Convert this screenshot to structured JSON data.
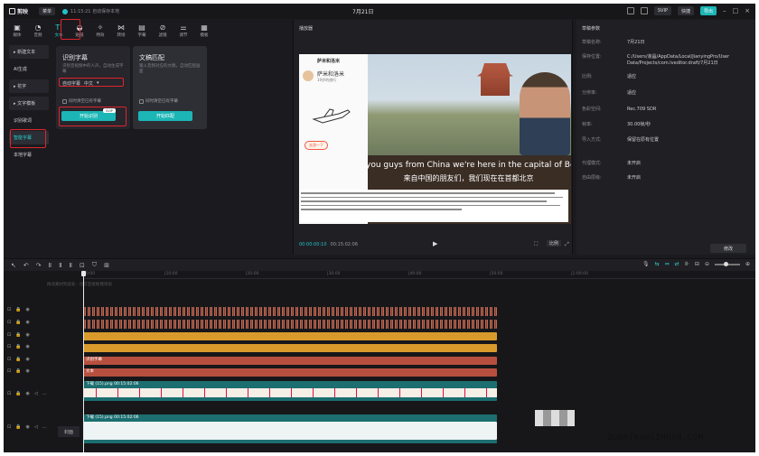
{
  "app": {
    "name": "剪映",
    "menu": "菜单",
    "project_title": "7月21日",
    "autosave": "11:15:21 自动保存本地"
  },
  "title_right": {
    "pro_label": "SVIP",
    "shortcut_label": "快捷",
    "export_label": "导出"
  },
  "toolbar": {
    "tools": [
      {
        "glyph": "▣",
        "label": "媒体"
      },
      {
        "glyph": "◔",
        "label": "音频"
      },
      {
        "glyph": "TI",
        "label": "文本"
      },
      {
        "glyph": "◒",
        "label": "贴纸"
      },
      {
        "glyph": "✧",
        "label": "特效"
      },
      {
        "glyph": "⋈",
        "label": "转场"
      },
      {
        "glyph": "▤",
        "label": "字幕"
      },
      {
        "glyph": "⊘",
        "label": "滤镜"
      },
      {
        "glyph": "⚌",
        "label": "调节"
      },
      {
        "glyph": "▦",
        "label": "模板"
      }
    ]
  },
  "sidebar": {
    "items": [
      {
        "label": "▸ 新建文本"
      },
      {
        "label": "AI生成"
      },
      {
        "label": "▸ 花字"
      },
      {
        "label": "▸ 文字模板"
      },
      {
        "label": "识别歌词"
      },
      {
        "label": "智能字幕"
      },
      {
        "label": "本地字幕"
      }
    ]
  },
  "card_recognize": {
    "title": "识别字幕",
    "desc": "识别音视频中的人声，自动生成字幕",
    "lang": "自动字幕",
    "lang2": "中文",
    "check": "同时清空已有字幕",
    "button": "开始识别",
    "badge": "SVIP"
  },
  "card_match": {
    "title": "文稿匹配",
    "desc": "输入音频对应的文稿，自动匹配画面",
    "check": "同时清空已有字幕",
    "button": "开始匹配"
  },
  "player": {
    "title": "播放器",
    "phone_title": "萨米和洛米",
    "phone_name": "萨米和洛米",
    "phone_sub": "19岁的旅行",
    "tag_text": "去游一下",
    "sub_en": "you guys from China we're here in the capital of Beijing",
    "sub_zh": "来自中国的朋友们，我们现在在首都北京",
    "timecode_current": "00:00:00:10",
    "timecode_total": "00:15:02:06",
    "ratio": "比例"
  },
  "props": {
    "title": "草稿参数",
    "rows": [
      {
        "k": "草稿名称:",
        "v": "7月21日"
      },
      {
        "k": "保存位置:",
        "v": "C:/Users/液晶/AppData/Local/JianyingPro/User Data/Projects/com.lveditor.draft/7月21日"
      },
      {
        "k": "比例:",
        "v": "适应"
      },
      {
        "k": "分辨率:",
        "v": "适应"
      },
      {
        "k": "色彩空间:",
        "v": "Rec.709 SDR"
      },
      {
        "k": "帧率:",
        "v": "30.00帧/秒"
      },
      {
        "k": "导入方式:",
        "v": "保留在原有位置"
      },
      {
        "k": "代理模式:",
        "v": "未开启"
      },
      {
        "k": "自由层级:",
        "v": "未开启"
      }
    ],
    "modify": "修改"
  },
  "timeline": {
    "ruler": [
      "00:00",
      "|10:00",
      "|20:00",
      "|30:00",
      "|40:00",
      "|50:00",
      "|1:00:00"
    ],
    "clip_hint": "拖动素材到此处 · 也可直接拖拽添加",
    "orange_label": "",
    "red1_label": "识别字幕",
    "red2_label": "文本",
    "teal1_label": "下载 (15).png 00:15:02:06",
    "teal2_label": "下载 (15).png 00:15:02:06",
    "main_label": "封面"
  },
  "watermark": "QUWAIWANGZHUAN.COM"
}
